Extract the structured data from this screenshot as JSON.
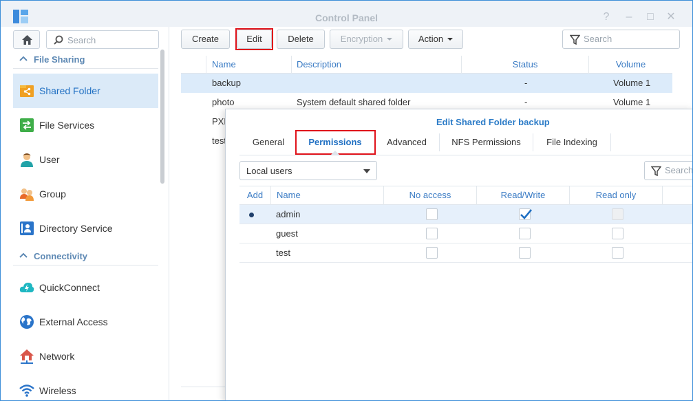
{
  "window": {
    "title": "Control Panel"
  },
  "sidebar": {
    "search_placeholder": "Search",
    "sections": [
      {
        "title": "File Sharing"
      },
      {
        "title": "Connectivity"
      }
    ],
    "items": [
      {
        "label": "Shared Folder",
        "icon": "shared-folder-icon",
        "active": true
      },
      {
        "label": "File Services",
        "icon": "file-services-icon"
      },
      {
        "label": "User",
        "icon": "user-icon"
      },
      {
        "label": "Group",
        "icon": "group-icon"
      },
      {
        "label": "Directory Service",
        "icon": "directory-service-icon"
      },
      {
        "label": "QuickConnect",
        "icon": "quickconnect-icon"
      },
      {
        "label": "External Access",
        "icon": "external-access-icon"
      },
      {
        "label": "Network",
        "icon": "network-icon"
      },
      {
        "label": "Wireless",
        "icon": "wireless-icon"
      }
    ]
  },
  "toolbar": {
    "create": "Create",
    "edit": "Edit",
    "delete": "Delete",
    "encryption": "Encryption",
    "action": "Action",
    "search_placeholder": "Search"
  },
  "grid": {
    "columns": [
      "Name",
      "Description",
      "Status",
      "Volume"
    ],
    "rows": [
      {
        "name": "backup",
        "description": "",
        "status": "-",
        "volume": "Volume 1"
      },
      {
        "name": "photo",
        "description": "System default shared folder",
        "status": "-",
        "volume": "Volume 1"
      },
      {
        "name": "PXE",
        "description": "",
        "status": "",
        "volume": ""
      },
      {
        "name": "test",
        "description": "",
        "status": "",
        "volume": ""
      }
    ]
  },
  "dialog": {
    "title": "Edit Shared Folder backup",
    "tabs": [
      "General",
      "Permissions",
      "Advanced",
      "NFS Permissions",
      "File Indexing"
    ],
    "active_tab": "Permissions",
    "user_type": "Local users",
    "search_placeholder": "Search",
    "columns": [
      "Add",
      "Name",
      "No access",
      "Read/Write",
      "Read only"
    ],
    "rows": [
      {
        "name": "admin",
        "no_access": false,
        "read_write": true,
        "read_only": false,
        "read_only_disabled": true,
        "selected": true
      },
      {
        "name": "guest",
        "no_access": false,
        "read_write": false,
        "read_only": false
      },
      {
        "name": "test",
        "no_access": false,
        "read_write": false,
        "read_only": false
      }
    ]
  },
  "colors": {
    "accent": "#2b7bc7",
    "highlight_box": "#e0121a",
    "selection": "#dcebfa"
  }
}
